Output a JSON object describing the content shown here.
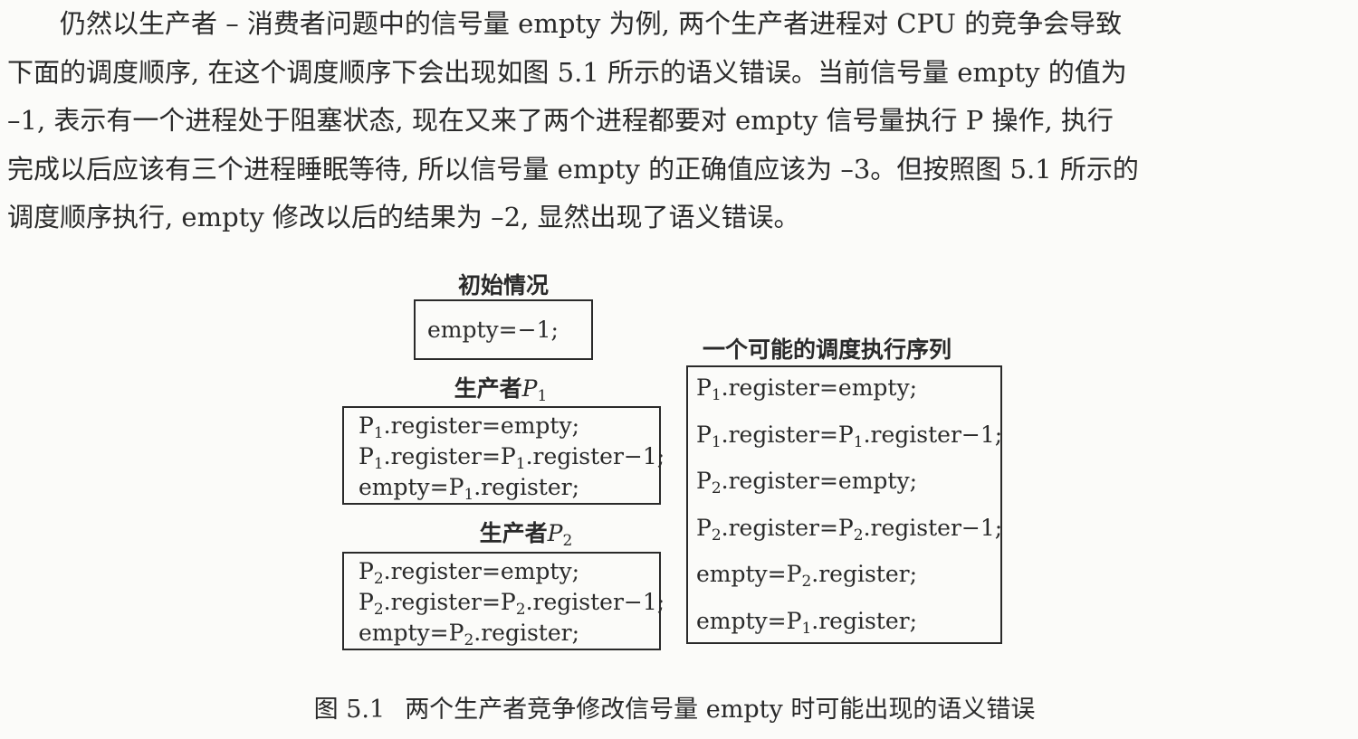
{
  "paragraph": {
    "lines": [
      "　　仍然以生产者 – 消费者问题中的信号量 empty 为例, 两个生产者进程对 CPU 的竞争会导致",
      "下面的调度顺序, 在这个调度顺序下会出现如图 5.1 所示的语义错误。当前信号量 empty 的值为",
      "–1, 表示有一个进程处于阻塞状态, 现在又来了两个进程都要对 empty 信号量执行 P 操作, 执行",
      "完成以后应该有三个进程睡眠等待, 所以信号量 empty 的正确值应该为 –3。但按照图 5.1 所示的",
      "调度顺序执行, empty 修改以后的结果为 –2, 显然出现了语义错误。"
    ]
  },
  "figure": {
    "initial": {
      "heading": "初始情况",
      "code": "empty=−1;"
    },
    "producer1": {
      "heading_prefix": "生产者",
      "heading_var": "P",
      "heading_sub": "1",
      "lines": [
        {
          "pre": "P",
          "sub": "1",
          "post": ".register=empty;"
        },
        {
          "pre": "P",
          "sub": "1",
          "mid": ".register=P",
          "sub2": "1",
          "post": ".register−1;"
        },
        {
          "pre": "empty=P",
          "sub": "1",
          "post": ".register;"
        }
      ]
    },
    "producer2": {
      "heading_prefix": "生产者",
      "heading_var": "P",
      "heading_sub": "2",
      "lines": [
        {
          "pre": "P",
          "sub": "2",
          "post": ".register=empty;"
        },
        {
          "pre": "P",
          "sub": "2",
          "mid": ".register=P",
          "sub2": "2",
          "post": ".register−1;"
        },
        {
          "pre": "empty=P",
          "sub": "2",
          "post": ".register;"
        }
      ]
    },
    "sequence": {
      "heading": "一个可能的调度执行序列",
      "lines": [
        {
          "pre": "P",
          "sub": "1",
          "post": ".register=empty;"
        },
        {
          "pre": "P",
          "sub": "1",
          "mid": ".register=P",
          "sub2": "1",
          "post": ".register−1;"
        },
        {
          "pre": "P",
          "sub": "2",
          "post": ".register=empty;"
        },
        {
          "pre": "P",
          "sub": "2",
          "mid": ".register=P",
          "sub2": "2",
          "post": ".register−1;"
        },
        {
          "pre": "empty=P",
          "sub": "2",
          "post": ".register;"
        },
        {
          "pre": "empty=P",
          "sub": "1",
          "post": ".register;"
        }
      ]
    },
    "caption": {
      "number": "图 5.1",
      "text": "两个生产者竞争修改信号量 empty 时可能出现的语义错误"
    }
  }
}
